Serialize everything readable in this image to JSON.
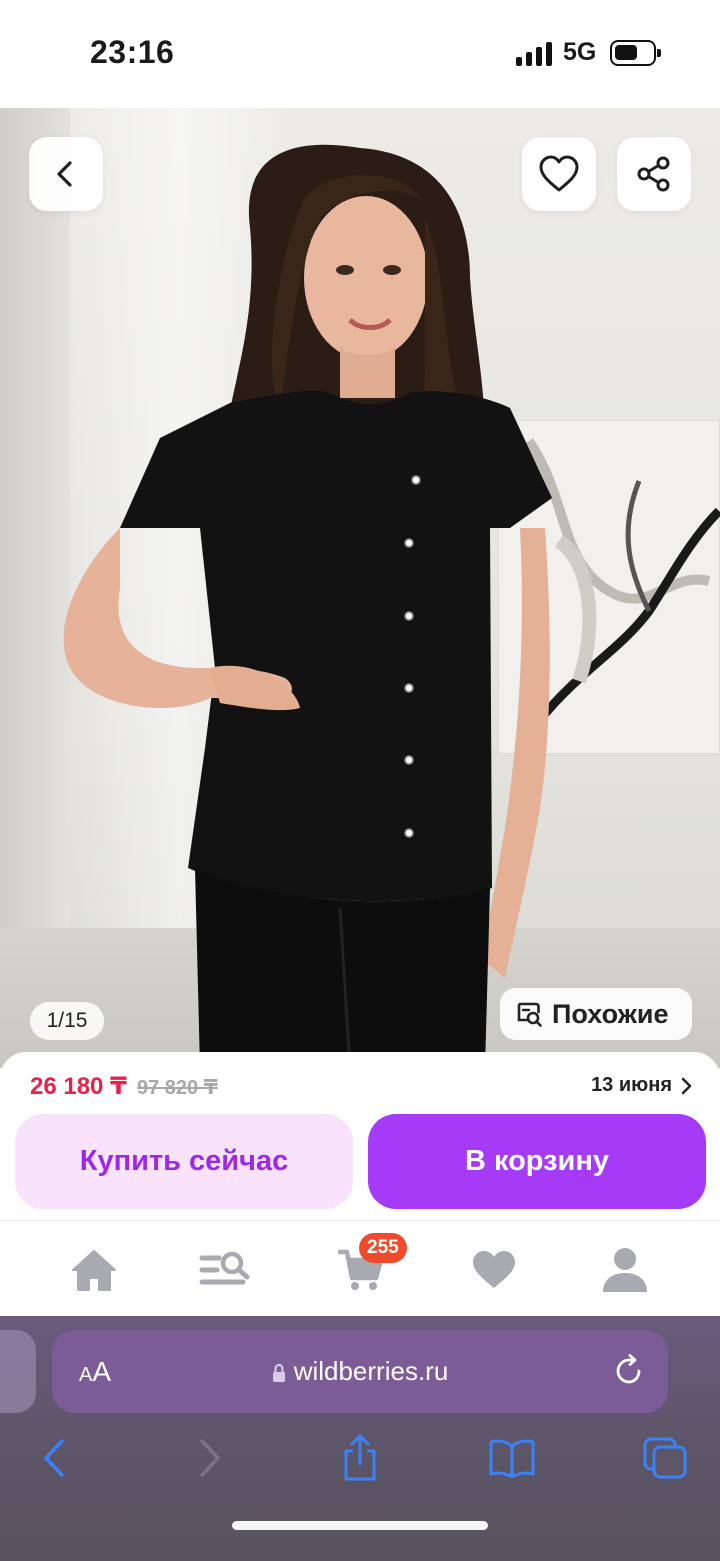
{
  "status_bar": {
    "time": "23:16",
    "network": "5G",
    "signal_bars": 4,
    "battery_level": 0.5
  },
  "product": {
    "image_counter": "1/15",
    "similar_label": "Похожие",
    "icons": {
      "back": "chevron-left-icon",
      "favorite": "heart-outline-icon",
      "share": "share-icon",
      "similar": "image-search-icon"
    }
  },
  "purchase": {
    "price_current": "26 180 ₸",
    "price_old": "97 820 ₸",
    "delivery_date": "13 июня",
    "buy_now_label": "Купить сейчас",
    "add_to_cart_label": "В корзину"
  },
  "tabbar": {
    "items": [
      {
        "id": "home",
        "icon": "home-icon"
      },
      {
        "id": "catalog",
        "icon": "catalog-search-icon"
      },
      {
        "id": "cart",
        "icon": "cart-icon",
        "badge": "255"
      },
      {
        "id": "favorites",
        "icon": "heart-icon"
      },
      {
        "id": "profile",
        "icon": "profile-icon"
      }
    ]
  },
  "browser": {
    "text_size_small": "A",
    "text_size_big": "A",
    "url": "wildberries.ru",
    "icons": [
      "lock-icon",
      "reload-icon",
      "back-arrow-icon",
      "forward-arrow-icon",
      "share-icon",
      "bookmarks-icon",
      "tabs-icon"
    ]
  },
  "colors": {
    "price_red": "#e6224b",
    "buy_now_bg": "#f9e3fc",
    "buy_now_text": "#9b29e6",
    "cart_button": "#a53bf7",
    "badge": "#f04a2d",
    "browser_bar": "#7b5c97",
    "safari_blue": "#3a82f7"
  }
}
